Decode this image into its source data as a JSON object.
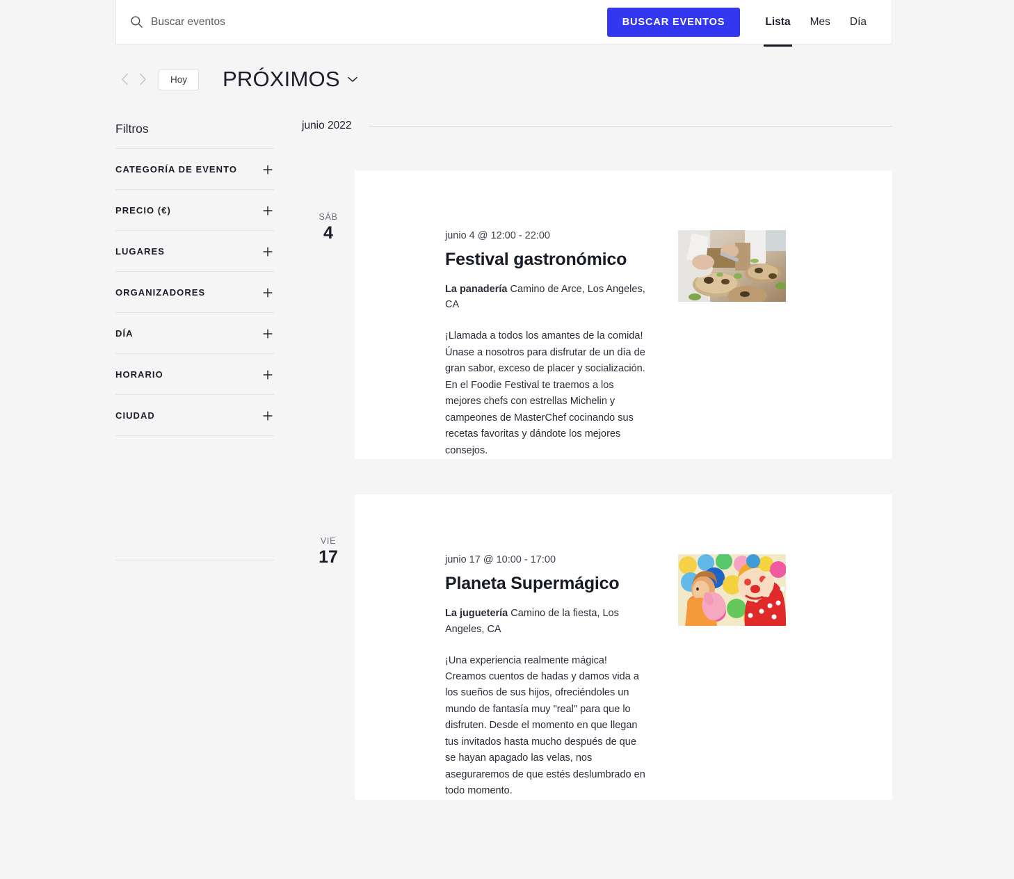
{
  "header": {
    "search": {
      "placeholder": "Buscar eventos",
      "value": "",
      "icon": "search-icon"
    },
    "find_button": "BUSCAR EVENTOS",
    "accent_color": "#3338f0",
    "views": [
      {
        "label": "Lista",
        "active": true
      },
      {
        "label": "Mes",
        "active": false
      },
      {
        "label": "Día",
        "active": false
      }
    ]
  },
  "nav": {
    "prev_icon": "chevron-left-icon",
    "next_icon": "chevron-right-icon",
    "today_label": "Hoy",
    "view_title": "PRÓXIMOS",
    "view_title_icon": "chevron-down-icon"
  },
  "sidebar": {
    "title": "Filtros",
    "filters": [
      {
        "label": "CATEGORÍA DE EVENTO",
        "icon": "plus-icon"
      },
      {
        "label": "PRECIO (€)",
        "icon": "plus-icon"
      },
      {
        "label": "LUGARES",
        "icon": "plus-icon"
      },
      {
        "label": "ORGANIZADORES",
        "icon": "plus-icon"
      },
      {
        "label": "DÍA",
        "icon": "plus-icon"
      },
      {
        "label": "HORARIO",
        "icon": "plus-icon"
      },
      {
        "label": "CIUDAD",
        "icon": "plus-icon"
      }
    ]
  },
  "content": {
    "month_label": "junio 2022",
    "events": [
      {
        "day_of_week": "SÁB",
        "day_number": "4",
        "time": "junio 4 @ 12:00 - 22:00",
        "title": "Festival gastronómico",
        "venue_name": "La panadería",
        "venue_address": " Camino de Arce, Los Angeles, CA",
        "description": "¡Llamada a todos los amantes de la comida! Únase a nosotros para disfrutar de un día de gran sabor, exceso de placer y socialización. En el Foodie Festival te traemos a los mejores chefs con estrellas Michelin y campeones de MasterChef cocinando sus recetas favoritas y dándote los mejores consejos.",
        "thumbnail_alt": "chefs-plating-food-photo"
      },
      {
        "day_of_week": "VIE",
        "day_number": "17",
        "time": "junio 17 @ 10:00 - 17:00",
        "title": "Planeta Supermágico",
        "venue_name": "La juguetería",
        "venue_address": " Camino de la fiesta, Los Angeles, CA",
        "description": "¡Una experiencia realmente mágica! Creamos cuentos de hadas y damos vida a los sueños de sus hijos, ofreciéndoles un mundo de fantasía muy \"real\" para que lo disfruten. Desde el momento en que llegan tus invitados hasta mucho después de que se hayan apagado las velas, nos aseguraremos de que estés deslumbrado en todo momento.",
        "thumbnail_alt": "clown-with-balloons-photo"
      }
    ]
  }
}
